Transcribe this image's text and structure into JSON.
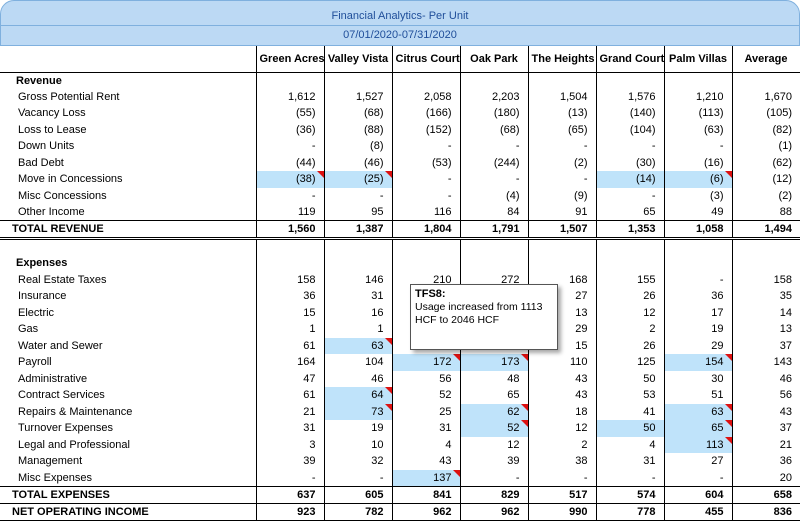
{
  "header": {
    "title": "Financial Analytics- Per Unit",
    "period": "07/01/2020-07/31/2020"
  },
  "columns": [
    "Green Acres",
    "Valley Vista",
    "Citrus Court",
    "Oak Park",
    "The Heights",
    "Grand Court",
    "Palm Villas",
    "Average"
  ],
  "revenue": {
    "section_label": "Revenue",
    "rows": [
      {
        "label": "Gross Potential Rent",
        "values": [
          "1,612",
          "1,527",
          "2,058",
          "2,203",
          "1,504",
          "1,576",
          "1,210",
          "1,670"
        ]
      },
      {
        "label": "Vacancy Loss",
        "values": [
          "(55)",
          "(68)",
          "(166)",
          "(180)",
          "(13)",
          "(140)",
          "(113)",
          "(105)"
        ]
      },
      {
        "label": "Loss to Lease",
        "values": [
          "(36)",
          "(88)",
          "(152)",
          "(68)",
          "(65)",
          "(104)",
          "(63)",
          "(82)"
        ]
      },
      {
        "label": "Down Units",
        "values": [
          "-",
          "(8)",
          "-",
          "-",
          "-",
          "-",
          "-",
          "(1)"
        ]
      },
      {
        "label": "Bad Debt",
        "values": [
          "(44)",
          "(46)",
          "(53)",
          "(244)",
          "(2)",
          "(30)",
          "(16)",
          "(62)"
        ]
      },
      {
        "label": "Move in Concessions",
        "values": [
          "(38)",
          "(25)",
          "-",
          "-",
          "-",
          "(14)",
          "(6)",
          "(12)"
        ]
      },
      {
        "label": "Misc Concessions",
        "values": [
          "-",
          "-",
          "-",
          "(4)",
          "(9)",
          "-",
          "(3)",
          "(2)"
        ]
      },
      {
        "label": "Other Income",
        "values": [
          "119",
          "95",
          "116",
          "84",
          "91",
          "65",
          "49",
          "88"
        ]
      }
    ],
    "total": {
      "label": "TOTAL REVENUE",
      "values": [
        "1,560",
        "1,387",
        "1,804",
        "1,791",
        "1,507",
        "1,353",
        "1,058",
        "1,494"
      ]
    }
  },
  "expenses": {
    "section_label": "Expenses",
    "rows": [
      {
        "label": "Real Estate Taxes",
        "values": [
          "158",
          "146",
          "210",
          "272",
          "168",
          "155",
          "-",
          "158"
        ]
      },
      {
        "label": "Insurance",
        "values": [
          "36",
          "31",
          "",
          "",
          "27",
          "26",
          "36",
          "35"
        ]
      },
      {
        "label": "Electric",
        "values": [
          "15",
          "16",
          "",
          "",
          "13",
          "12",
          "17",
          "14"
        ]
      },
      {
        "label": "Gas",
        "values": [
          "1",
          "1",
          "",
          "",
          "29",
          "2",
          "19",
          "13"
        ]
      },
      {
        "label": "Water and Sewer",
        "values": [
          "61",
          "63",
          "",
          "",
          "15",
          "26",
          "29",
          "37"
        ]
      },
      {
        "label": "Payroll",
        "values": [
          "164",
          "104",
          "172",
          "173",
          "110",
          "125",
          "154",
          "143"
        ]
      },
      {
        "label": "Administrative",
        "values": [
          "47",
          "46",
          "56",
          "48",
          "43",
          "50",
          "30",
          "46"
        ]
      },
      {
        "label": "Contract Services",
        "values": [
          "61",
          "64",
          "52",
          "65",
          "43",
          "53",
          "51",
          "56"
        ]
      },
      {
        "label": "Repairs & Maintenance",
        "values": [
          "21",
          "73",
          "25",
          "62",
          "18",
          "41",
          "63",
          "43"
        ]
      },
      {
        "label": "Turnover Expenses",
        "values": [
          "31",
          "19",
          "31",
          "52",
          "12",
          "50",
          "65",
          "37"
        ]
      },
      {
        "label": "Legal and Professional",
        "values": [
          "3",
          "10",
          "4",
          "12",
          "2",
          "4",
          "113",
          "21"
        ]
      },
      {
        "label": "Management",
        "values": [
          "39",
          "32",
          "43",
          "39",
          "38",
          "31",
          "27",
          "36"
        ]
      },
      {
        "label": "Misc Expenses",
        "values": [
          "-",
          "-",
          "137",
          "-",
          "-",
          "-",
          "-",
          "20"
        ]
      }
    ],
    "total": {
      "label": "TOTAL EXPENSES",
      "values": [
        "637",
        "605",
        "841",
        "829",
        "517",
        "574",
        "604",
        "658"
      ]
    },
    "noi": {
      "label": "NET OPERATING INCOME",
      "values": [
        "923",
        "782",
        "962",
        "962",
        "990",
        "778",
        "455",
        "836"
      ]
    }
  },
  "comment": {
    "author": "TFS8:",
    "text": "Usage increased from 1113 HCF to 2046 HCF"
  },
  "colors": {
    "highlight": "#bfe3fa",
    "flag": "#dd1111",
    "header_bg": "#bcd9f4",
    "header_text": "#1f4e9a"
  }
}
